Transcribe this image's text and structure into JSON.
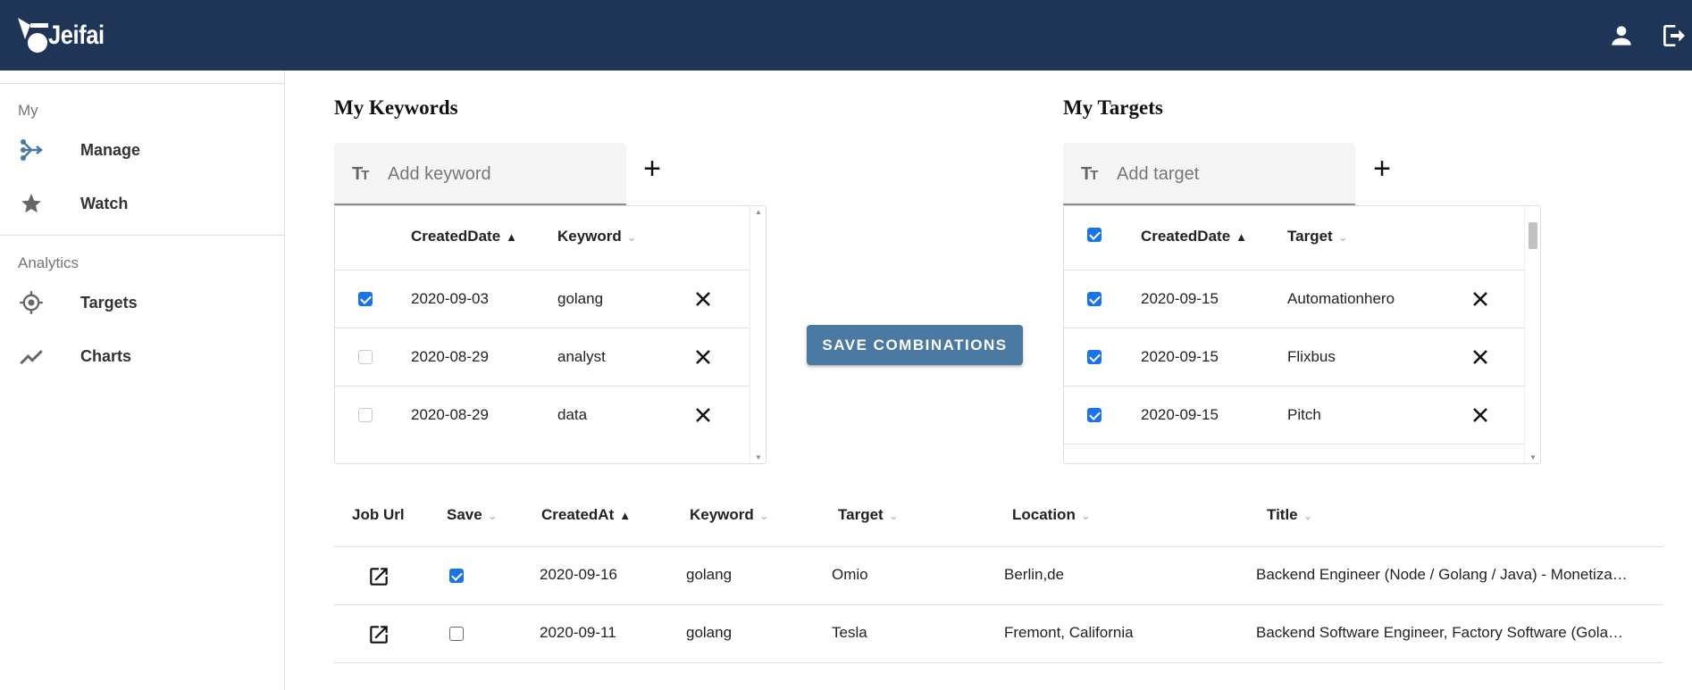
{
  "app": {
    "name": "Jeifai",
    "colors": {
      "topbar": "#1f3557",
      "accent": "#4a7aa3",
      "checkbox": "#1a73e8"
    }
  },
  "topbar": {
    "user_icon": "account-icon",
    "logout_icon": "logout-icon"
  },
  "sidebar": {
    "sections": [
      {
        "title": "My",
        "items": [
          {
            "label": "Manage",
            "icon": "manage-icon"
          },
          {
            "label": "Watch",
            "icon": "star-icon"
          }
        ]
      },
      {
        "title": "Analytics",
        "items": [
          {
            "label": "Targets",
            "icon": "target-icon"
          },
          {
            "label": "Charts",
            "icon": "chart-line-icon"
          }
        ]
      }
    ]
  },
  "keywords": {
    "title": "My Keywords",
    "add_placeholder": "Add keyword",
    "columns": {
      "created": "CreatedDate",
      "value": "Keyword"
    },
    "rows": [
      {
        "checked": true,
        "date": "2020-09-03",
        "value": "golang"
      },
      {
        "checked": false,
        "date": "2020-08-29",
        "value": "analyst"
      },
      {
        "checked": false,
        "date": "2020-08-29",
        "value": "data"
      }
    ]
  },
  "targets": {
    "title": "My Targets",
    "add_placeholder": "Add target",
    "select_all_checked": true,
    "columns": {
      "created": "CreatedDate",
      "value": "Target"
    },
    "rows": [
      {
        "checked": true,
        "date": "2020-09-15",
        "value": "Automationhero"
      },
      {
        "checked": true,
        "date": "2020-09-15",
        "value": "Flixbus"
      },
      {
        "checked": true,
        "date": "2020-09-15",
        "value": "Pitch"
      }
    ]
  },
  "save_combinations_label": "SAVE COMBINATIONS",
  "jobs": {
    "columns": {
      "url": "Job Url",
      "save": "Save",
      "created": "CreatedAt",
      "keyword": "Keyword",
      "target": "Target",
      "location": "Location",
      "title": "Title"
    },
    "rows": [
      {
        "saved": true,
        "created": "2020-09-16",
        "keyword": "golang",
        "target": "Omio",
        "location": "Berlin,de",
        "title": "Backend Engineer (Node / Golang / Java) - Monetiza…"
      },
      {
        "saved": false,
        "created": "2020-09-11",
        "keyword": "golang",
        "target": "Tesla",
        "location": "Fremont, California",
        "title": "Backend Software Engineer, Factory Software (Gola…"
      }
    ]
  }
}
